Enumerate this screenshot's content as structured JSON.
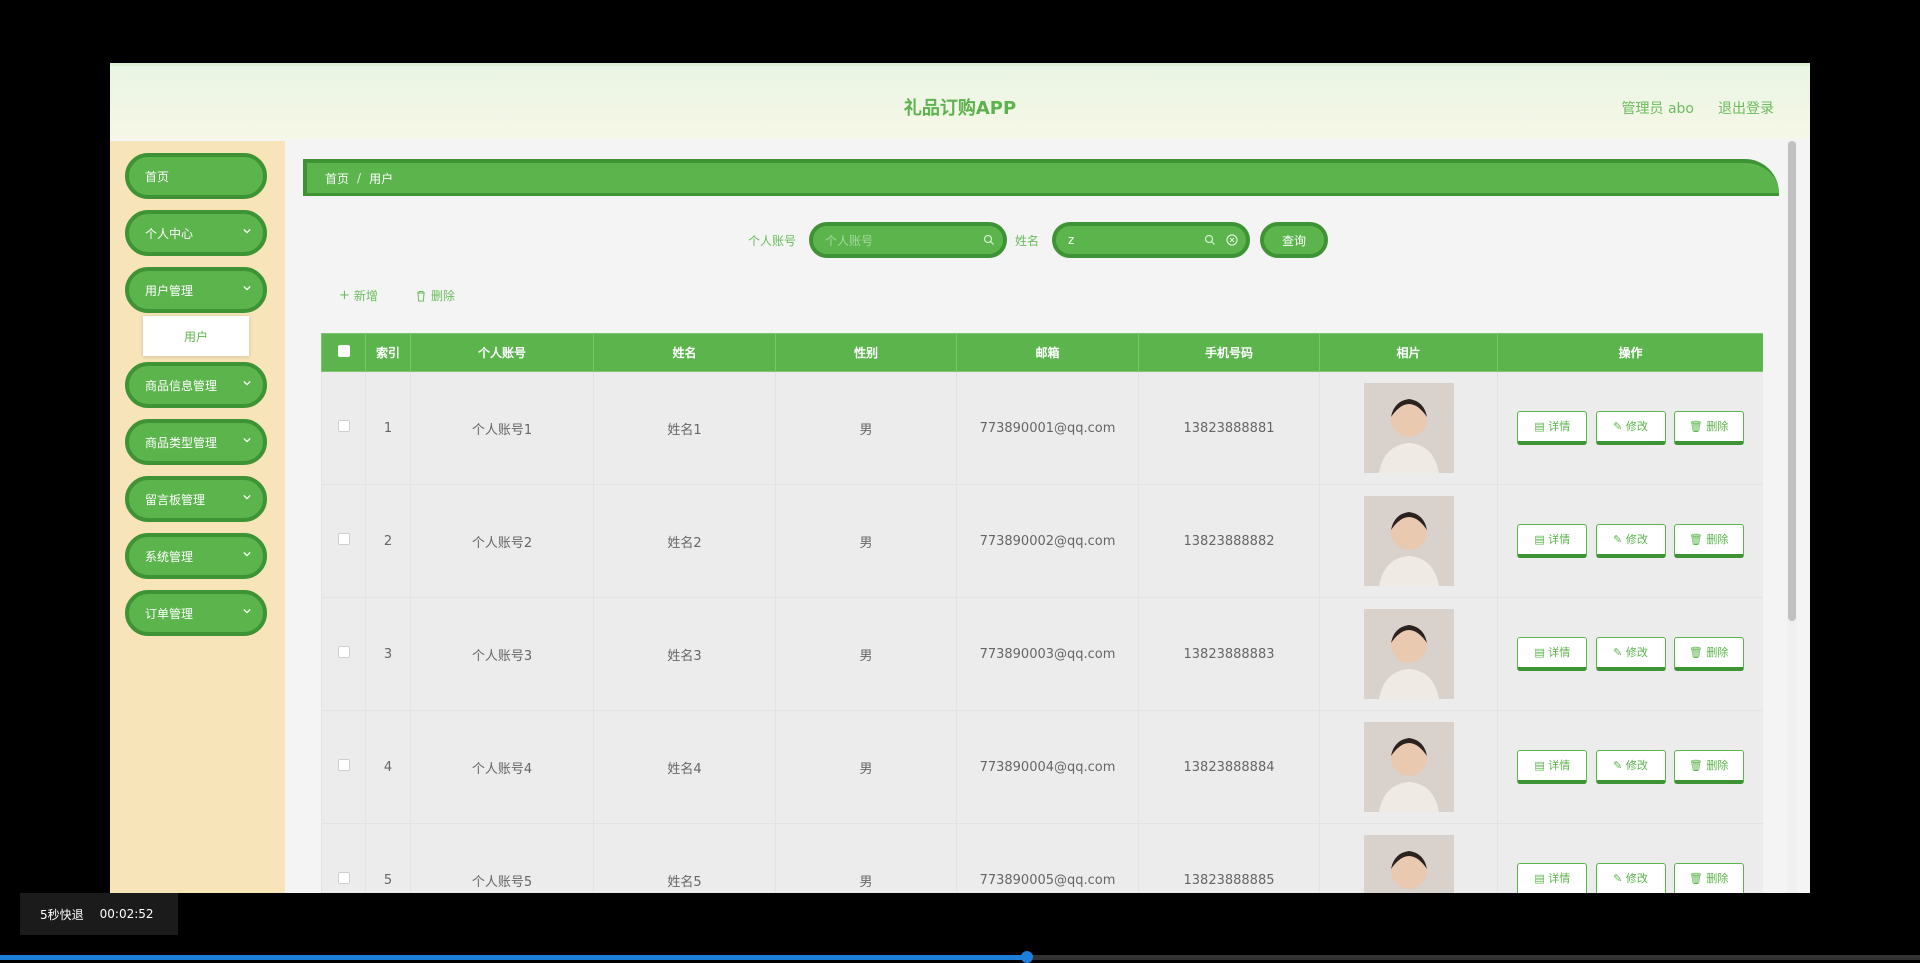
{
  "app": {
    "title": "礼品订购APP",
    "admin": "管理员 abo",
    "logout": "退出登录"
  },
  "sidebar": {
    "items": [
      {
        "label": "首页",
        "has_chevron": false
      },
      {
        "label": "个人中心",
        "has_chevron": true
      },
      {
        "label": "用户管理",
        "has_chevron": true
      },
      {
        "label": "商品信息管理",
        "has_chevron": true
      },
      {
        "label": "商品类型管理",
        "has_chevron": true
      },
      {
        "label": "留言板管理",
        "has_chevron": true
      },
      {
        "label": "系统管理",
        "has_chevron": true
      },
      {
        "label": "订单管理",
        "has_chevron": true
      }
    ],
    "submenu_item": "用户"
  },
  "breadcrumb": {
    "home": "首页",
    "sep": "/",
    "current": "用户"
  },
  "search": {
    "account_label": "个人账号",
    "account_placeholder": "个人账号",
    "name_label": "姓名",
    "name_value": "z",
    "query_button": "查询"
  },
  "toolbar": {
    "add_label": "新增",
    "delete_label": "删除"
  },
  "table": {
    "headers": [
      "索引",
      "个人账号",
      "姓名",
      "性别",
      "邮箱",
      "手机号码",
      "相片",
      "操作"
    ],
    "rows": [
      {
        "index": "1",
        "account": "个人账号1",
        "name": "姓名1",
        "gender": "男",
        "email": "773890001@qq.com",
        "phone": "13823888881"
      },
      {
        "index": "2",
        "account": "个人账号2",
        "name": "姓名2",
        "gender": "男",
        "email": "773890002@qq.com",
        "phone": "13823888882"
      },
      {
        "index": "3",
        "account": "个人账号3",
        "name": "姓名3",
        "gender": "男",
        "email": "773890003@qq.com",
        "phone": "13823888883"
      },
      {
        "index": "4",
        "account": "个人账号4",
        "name": "姓名4",
        "gender": "男",
        "email": "773890004@qq.com",
        "phone": "13823888884"
      },
      {
        "index": "5",
        "account": "个人账号5",
        "name": "姓名5",
        "gender": "男",
        "email": "773890005@qq.com",
        "phone": "13823888885"
      }
    ],
    "row_actions": {
      "detail": "详情",
      "edit": "修改",
      "delete": "删除"
    }
  },
  "video": {
    "speed_label": "5秒快退",
    "timestamp": "00:02:52",
    "progress": 0.535
  },
  "colors": {
    "primary": "#5bb44c",
    "primary_dark": "#3e9434",
    "sidebar_bg": "#f7e4b8",
    "accent_text": "#6bbc5e"
  }
}
